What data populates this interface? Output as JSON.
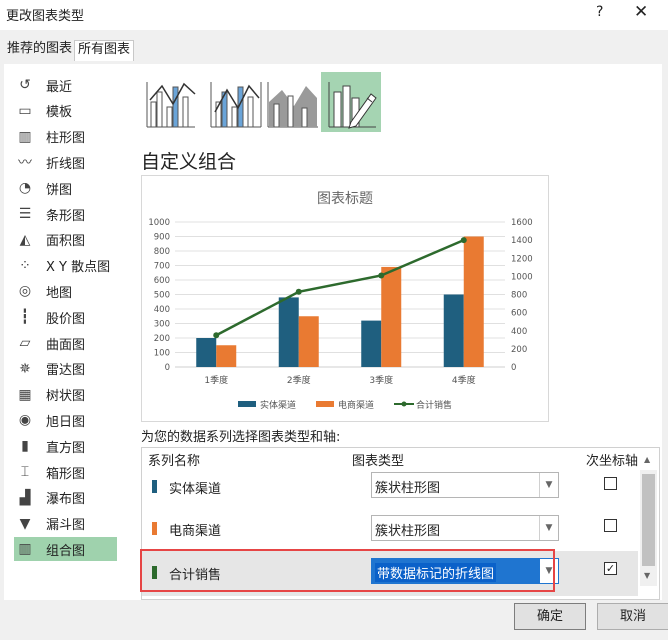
{
  "window": {
    "title": "更改图表类型",
    "help": "?",
    "close": "✕"
  },
  "tabs": {
    "recommended": "推荐的图表",
    "all": "所有图表"
  },
  "categories": [
    {
      "label": "最近",
      "icon": "recent-icon"
    },
    {
      "label": "模板",
      "icon": "template-icon"
    },
    {
      "label": "柱形图",
      "icon": "column-chart-icon"
    },
    {
      "label": "折线图",
      "icon": "line-chart-icon"
    },
    {
      "label": "饼图",
      "icon": "pie-chart-icon"
    },
    {
      "label": "条形图",
      "icon": "bar-chart-icon"
    },
    {
      "label": "面积图",
      "icon": "area-chart-icon"
    },
    {
      "label": "X Y 散点图",
      "icon": "scatter-chart-icon"
    },
    {
      "label": "地图",
      "icon": "map-chart-icon"
    },
    {
      "label": "股价图",
      "icon": "stock-chart-icon"
    },
    {
      "label": "曲面图",
      "icon": "surface-chart-icon"
    },
    {
      "label": "雷达图",
      "icon": "radar-chart-icon"
    },
    {
      "label": "树状图",
      "icon": "treemap-chart-icon"
    },
    {
      "label": "旭日图",
      "icon": "sunburst-chart-icon"
    },
    {
      "label": "直方图",
      "icon": "histogram-chart-icon"
    },
    {
      "label": "箱形图",
      "icon": "box-whisker-chart-icon"
    },
    {
      "label": "瀑布图",
      "icon": "waterfall-chart-icon"
    },
    {
      "label": "漏斗图",
      "icon": "funnel-chart-icon"
    },
    {
      "label": "组合图",
      "icon": "combo-chart-icon",
      "selected": true
    }
  ],
  "heading": "自定义组合",
  "chart_data": {
    "type": "bar",
    "title": "图表标题",
    "categories": [
      "1季度",
      "2季度",
      "3季度",
      "4季度"
    ],
    "series": [
      {
        "name": "实体渠道",
        "type": "bar",
        "axis": "primary",
        "color": "#1f5f7f",
        "values": [
          200,
          480,
          320,
          500
        ]
      },
      {
        "name": "电商渠道",
        "type": "bar",
        "axis": "primary",
        "color": "#e97a32",
        "values": [
          150,
          350,
          690,
          900
        ]
      },
      {
        "name": "合计销售",
        "type": "line",
        "axis": "secondary",
        "color": "#2d6a2d",
        "values": [
          350,
          830,
          1010,
          1400
        ]
      }
    ],
    "y_primary": {
      "min": 0,
      "max": 1000,
      "ticks": [
        "0",
        "100",
        "200",
        "300",
        "400",
        "500",
        "600",
        "700",
        "800",
        "900",
        "1000"
      ]
    },
    "y_secondary": {
      "min": 0,
      "max": 1600,
      "ticks": [
        "0",
        "200",
        "400",
        "600",
        "800",
        "1000",
        "1200",
        "1400",
        "1600"
      ]
    },
    "grid": true,
    "legend": "bottom"
  },
  "series_prompt": "为您的数据系列选择图表类型和轴:",
  "table": {
    "col_name": "系列名称",
    "col_type": "图表类型",
    "col_axis": "次坐标轴",
    "rows": [
      {
        "name": "实体渠道",
        "color": "#1f5f7f",
        "type": "簇状柱形图",
        "secondary": false
      },
      {
        "name": "电商渠道",
        "color": "#e97a32",
        "type": "簇状柱形图",
        "secondary": false
      },
      {
        "name": "合计销售",
        "color": "#2d6a2d",
        "type": "带数据标记的折线图",
        "secondary": true
      }
    ]
  },
  "buttons": {
    "ok": "确定",
    "cancel": "取消"
  }
}
